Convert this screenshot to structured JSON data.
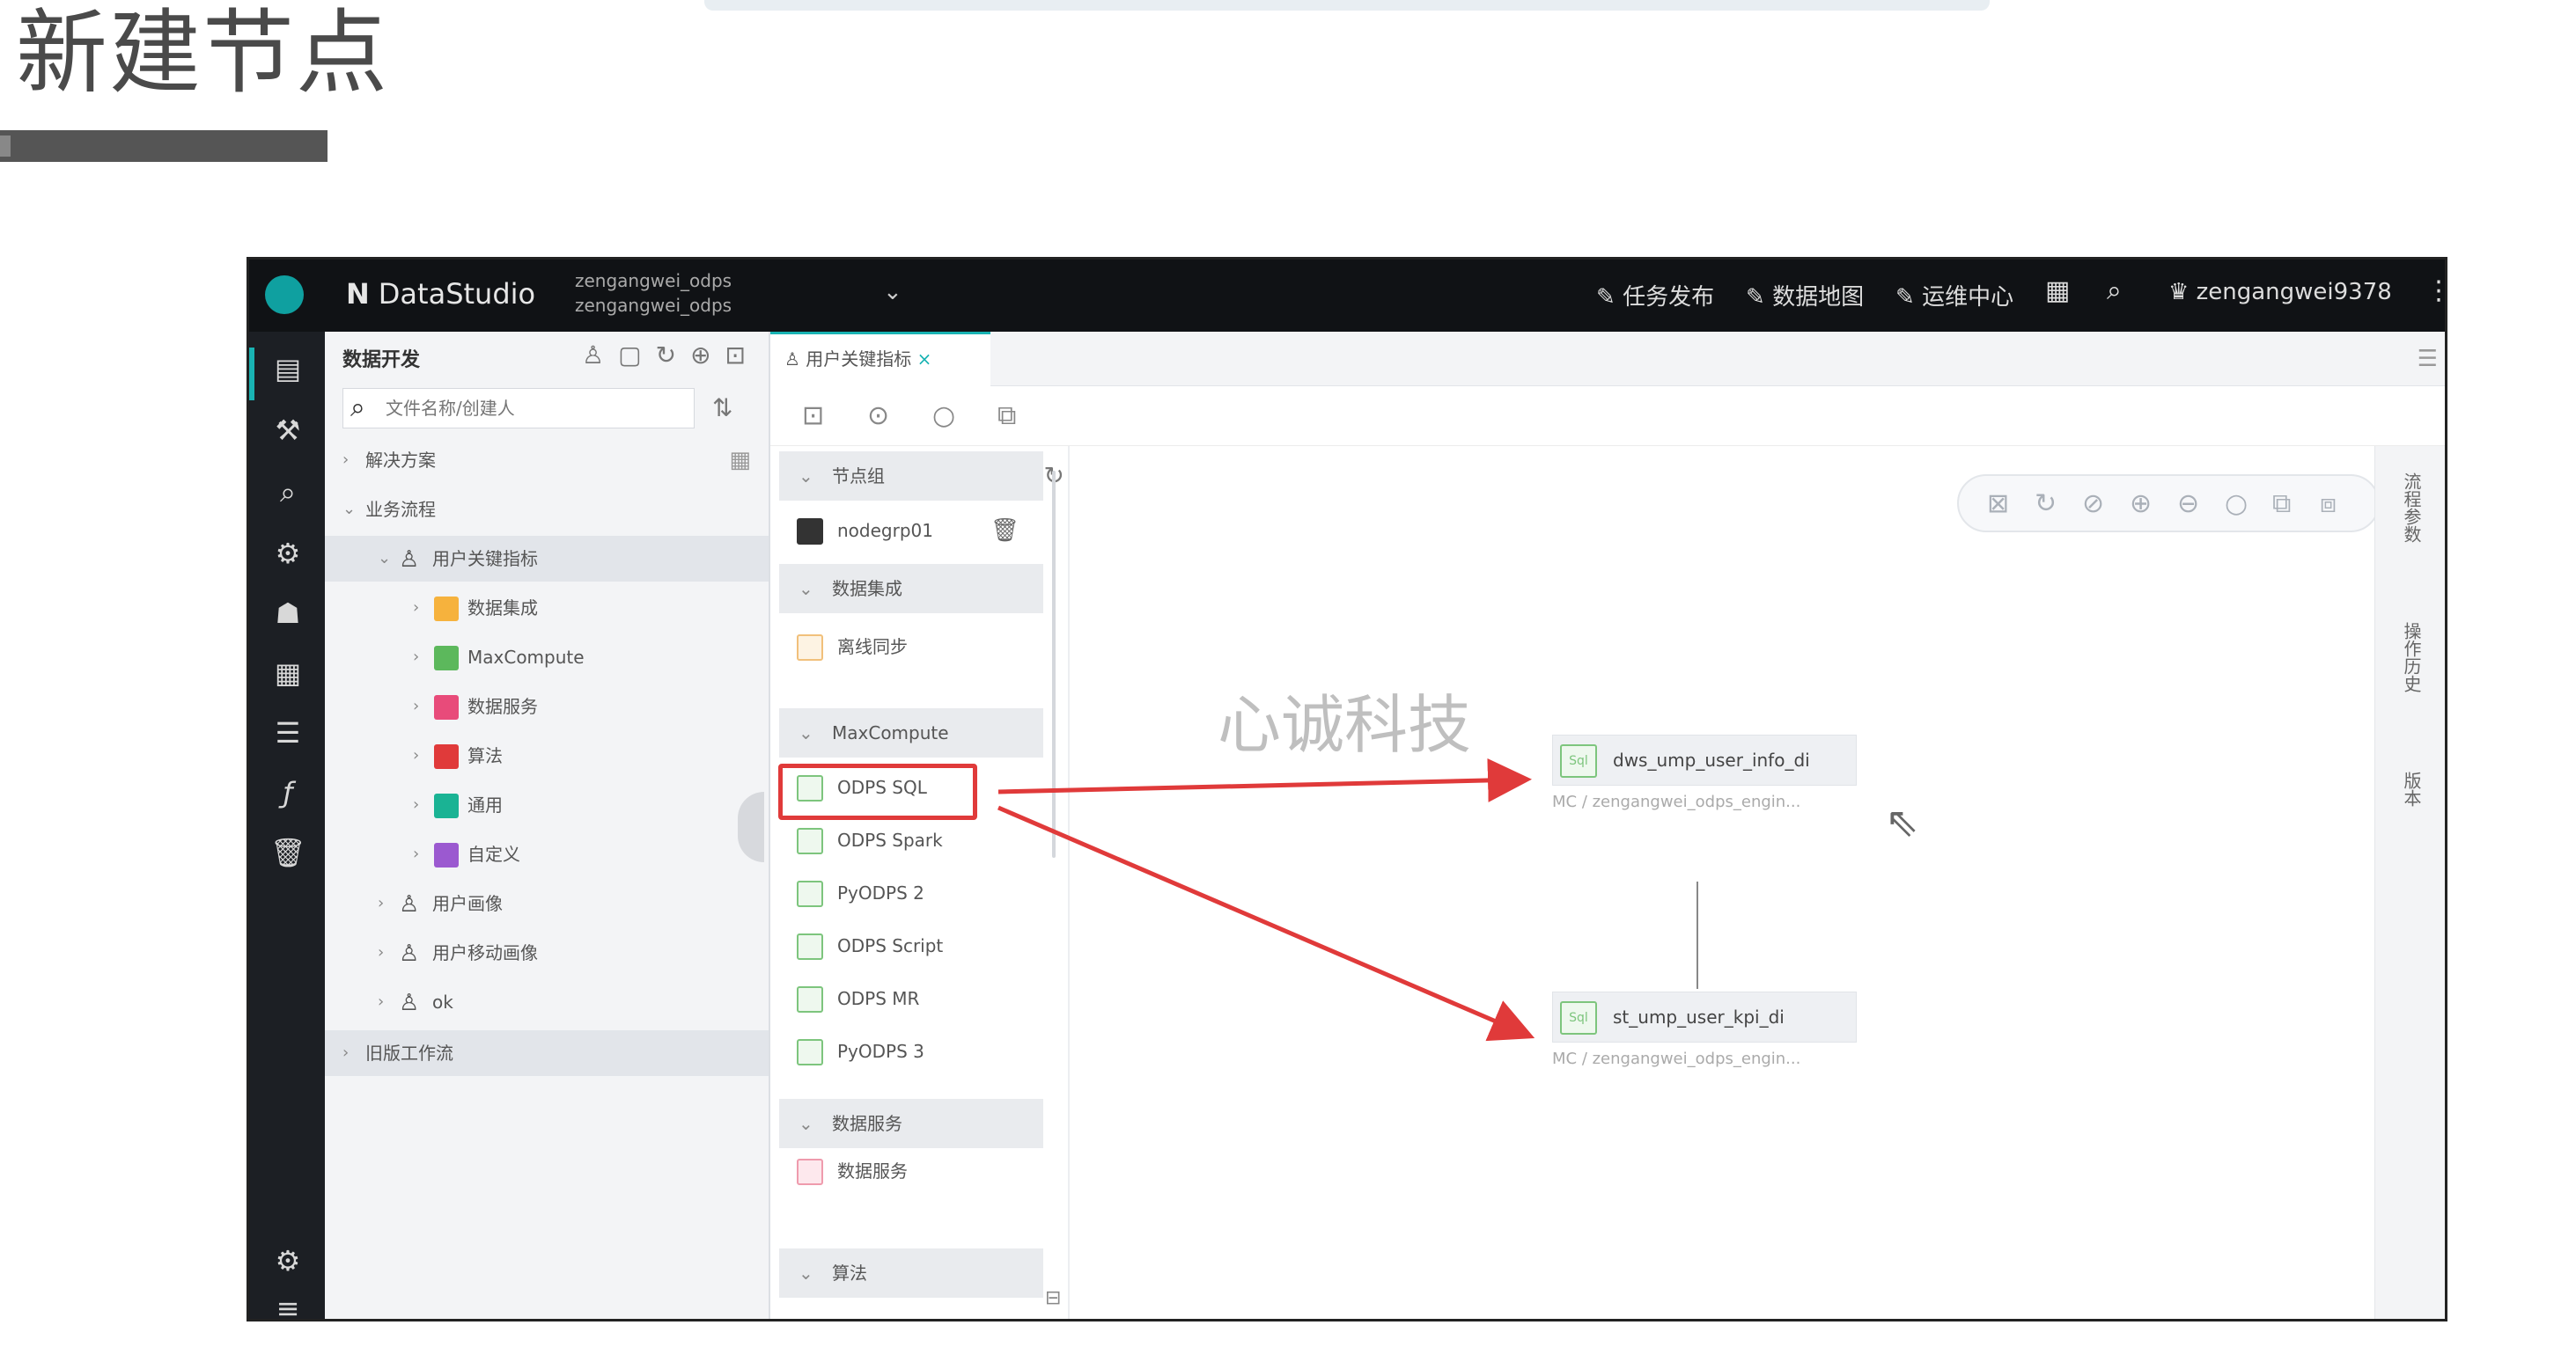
{
  "slide": {
    "title": "新建节点"
  },
  "topbar": {
    "brand_mark": "N",
    "brand": "DataStudio",
    "workspace_line1": "zengangwei_odps",
    "workspace_line2": "zengangwei_odps",
    "actions": [
      "任务发布",
      "数据地图",
      "运维中心"
    ],
    "user": "zengangwei9378"
  },
  "directory": {
    "header": "数据开发",
    "search_placeholder": "文件名称/创建人",
    "tree": [
      {
        "label": "解决方案",
        "level": 0,
        "expanded": false
      },
      {
        "label": "业务流程",
        "level": 0,
        "expanded": true
      },
      {
        "label": "用户关键指标",
        "level": 1,
        "expanded": true,
        "selected": true
      },
      {
        "label": "数据集成",
        "level": 2,
        "icon_color": "#f6b23d"
      },
      {
        "label": "MaxCompute",
        "level": 2,
        "icon_color": "#5cb85c"
      },
      {
        "label": "数据服务",
        "level": 2,
        "icon_color": "#e84b7a"
      },
      {
        "label": "算法",
        "level": 2,
        "icon_color": "#e03a3a"
      },
      {
        "label": "通用",
        "level": 2,
        "icon_color": "#1ab394"
      },
      {
        "label": "自定义",
        "level": 2,
        "icon_color": "#9b59d0"
      },
      {
        "label": "用户画像",
        "level": 1
      },
      {
        "label": "用户移动画像",
        "level": 1
      },
      {
        "label": "ok",
        "level": 1
      },
      {
        "label": "旧版工作流",
        "level": 0
      }
    ]
  },
  "editor": {
    "tab_label": "用户关键指标",
    "palette": {
      "groups": [
        {
          "label": "节点组",
          "items": [
            {
              "label": "nodegrp01",
              "style": "dark"
            }
          ]
        },
        {
          "label": "数据集成",
          "items": [
            {
              "label": "离线同步",
              "style": "orange"
            }
          ]
        },
        {
          "label": "MaxCompute",
          "items": [
            {
              "label": "ODPS SQL",
              "style": "green",
              "highlighted": true
            },
            {
              "label": "ODPS Spark",
              "style": "green"
            },
            {
              "label": "PyODPS 2",
              "style": "green"
            },
            {
              "label": "ODPS Script",
              "style": "green"
            },
            {
              "label": "ODPS MR",
              "style": "green"
            },
            {
              "label": "PyODPS 3",
              "style": "green"
            }
          ]
        },
        {
          "label": "数据服务",
          "items": [
            {
              "label": "数据服务",
              "style": "pink"
            }
          ]
        },
        {
          "label": "算法",
          "items": []
        }
      ]
    },
    "canvas": {
      "watermark": "心诚科技",
      "nodes": [
        {
          "label": "dws_ump_user_info_di",
          "type_badge": "Sql",
          "subtitle": "MC / zengangwei_odps_engin..."
        },
        {
          "label": "st_ump_user_kpi_di",
          "type_badge": "Sql",
          "subtitle": "MC / zengangwei_odps_engin..."
        }
      ]
    },
    "right_panel": [
      "流程参数",
      "操作历史",
      "版本"
    ]
  },
  "colors": {
    "accent": "#19b3b3",
    "highlight": "#e03a3a",
    "topbar": "#101215",
    "rail": "#1c1f24"
  },
  "icons": {
    "rail": [
      "data-dev-icon",
      "manual-icon",
      "search-icon",
      "component-icon",
      "ops-icon",
      "table-icon",
      "list-icon",
      "function-icon",
      "recycle-icon",
      "settings-icon",
      "collapse-icon"
    ],
    "canvas_tools": [
      "fit-icon",
      "refresh-icon",
      "auto-layout-icon",
      "zoom-in-icon",
      "zoom-out-icon",
      "reset-icon",
      "fullscreen-icon",
      "format-icon"
    ]
  }
}
